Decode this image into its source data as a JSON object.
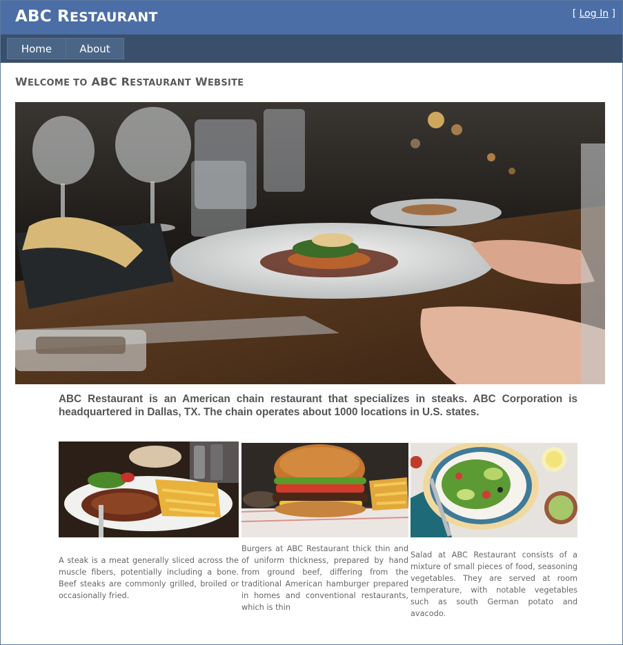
{
  "header": {
    "title_first": "ABC",
    "title_r": "R",
    "title_rest": "ESTAURANT",
    "login_open": "[ ",
    "login_label": "Log In",
    "login_close": " ]"
  },
  "nav": {
    "items": [
      {
        "label": "Home"
      },
      {
        "label": "About"
      }
    ]
  },
  "main": {
    "welcome": {
      "w": "W",
      "w_rest": "ELCOME TO",
      "abc": " ABC ",
      "r": "R",
      "r_rest": "ESTAURANT",
      "ws": " W",
      "ws_rest": "EBSITE"
    },
    "intro": "ABC Restaurant is an American chain restaurant that specializes in steaks. ABC Corporation is headquartered in Dallas, TX. The chain operates about 1000 locations in U.S. states.",
    "cards": [
      {
        "text": "A steak is a meat generally sliced across the muscle fibers, potentially including a bone. Beef steaks are commonly grilled, broiled or occasionally fried."
      },
      {
        "text": "Burgers at ABC Restaurant thick thin and of uniform thickness, prepared by hand from ground beef, differing from the traditional American hamburger prepared in homes and conventional restaurants, which is thin"
      },
      {
        "text": "Salad at ABC Restaurant consists of a mixture of small pieces of food, seasoning vegetables. They are served at room temperature, with notable vegetables such as south German potato and avacodo."
      }
    ]
  },
  "colors": {
    "header_bg": "#4b6ea6",
    "nav_bg": "#3a4f6b",
    "nav_item_bg": "#4a6585",
    "heading_text": "#5a5a5a",
    "body_text": "#666666"
  }
}
